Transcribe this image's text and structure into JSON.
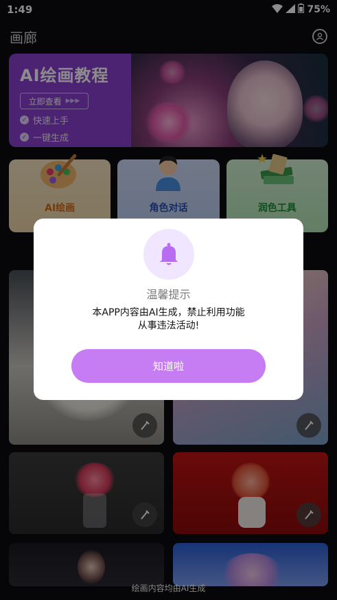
{
  "status": {
    "time": "1:49",
    "battery": "75%"
  },
  "header": {
    "title": "画廊",
    "profile_icon": "user-icon"
  },
  "banner": {
    "title": "AI绘画教程",
    "button": "立即查看",
    "features": [
      "快速上手",
      "一键生成"
    ],
    "accent": "#8a3fcf"
  },
  "features": [
    {
      "label": "AI绘画",
      "icon": "palette-icon"
    },
    {
      "label": "角色对话",
      "icon": "character-icon"
    },
    {
      "label": "润色工具",
      "icon": "books-icon"
    }
  ],
  "dialog": {
    "title": "温馨提示",
    "message_line1": "本APP内容由AI生成，禁止利用功能",
    "message_line2": "从事违法活动!",
    "confirm": "知道啦",
    "accent": "#c67cf2",
    "icon": "bell-icon"
  },
  "footer": {
    "note": "绘画内容均由AI生成"
  }
}
